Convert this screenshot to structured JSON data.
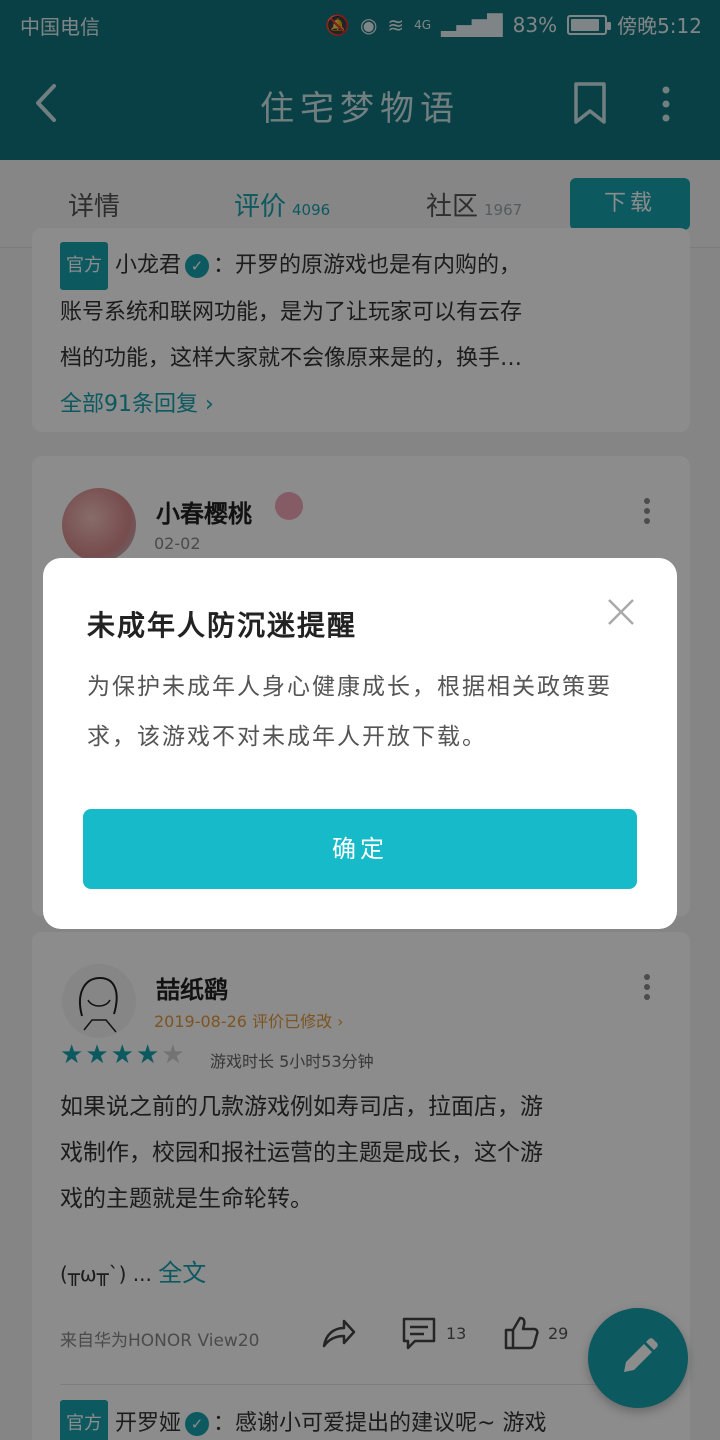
{
  "status_bar": {
    "carrier": "中国电信",
    "network": "4G",
    "battery": "83%",
    "time": "傍晚5:12"
  },
  "header": {
    "title": "住宅梦物语"
  },
  "tabs": [
    {
      "label": "详情",
      "count": ""
    },
    {
      "label": "评价",
      "count": "4096"
    },
    {
      "label": "社区",
      "count": "1967"
    }
  ],
  "download_label": "下载",
  "reply_card": {
    "badge": "官方",
    "author": "小龙君",
    "text_line1": "：开罗的原游戏也是有内购的，",
    "text_line2": "账号系统和联网功能，是为了让玩家可以有云存",
    "text_line3": "档的功能，这样大家就不会像原来是的，换手…",
    "all_replies": "全部91条回复"
  },
  "review1": {
    "author": "小春樱桃",
    "date": "02-02"
  },
  "review2": {
    "author": "喆纸鹞",
    "date": "2019-08-26",
    "edited": "评价已修改",
    "rating": 4,
    "rating_max": 5,
    "playtime": "游戏时长 5小时53分钟",
    "body_line1": "如果说之前的几款游戏例如寿司店，拉面店，游",
    "body_line2": "戏制作，校园和报社运营的主题是成长，这个游",
    "body_line3": "戏的主题就是生命轮转。",
    "kaomoji": "(╥ω╥`) ...",
    "full_text": "全文",
    "device": "来自华为HONOR View20",
    "comments": "13",
    "likes": "29",
    "official_badge": "官方",
    "official_author": "开罗娅",
    "official_reply": "：感谢小可爱提出的建议呢~ 游戏"
  },
  "dialog": {
    "title": "未成年人防沉迷提醒",
    "body": "为保护未成年人身心健康成长，根据相关政策要求，该游戏不对未成年人开放下载。",
    "confirm": "确定"
  },
  "colors": {
    "accent": "#16a2b0",
    "header": "#12767f",
    "confirm": "#16bac8",
    "edited": "#e29a3c"
  }
}
